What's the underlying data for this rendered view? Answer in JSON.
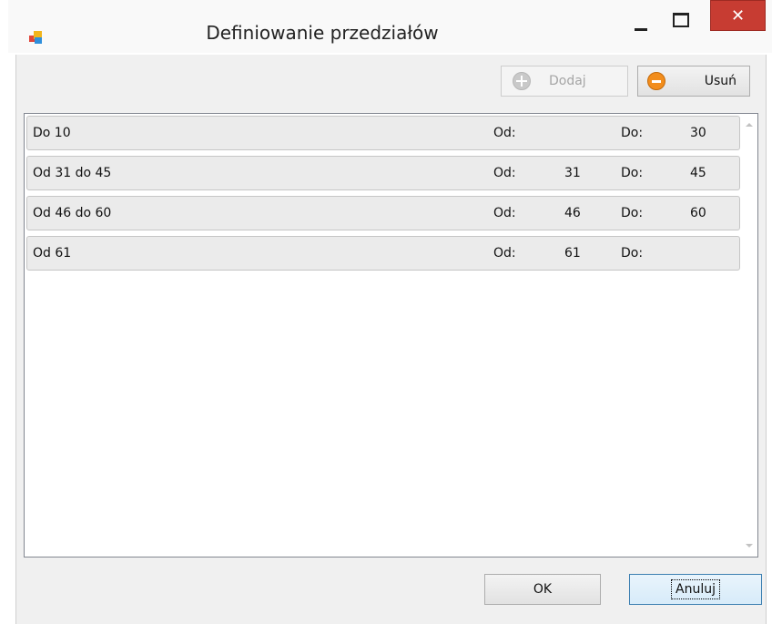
{
  "window": {
    "title": "Definiowanie przedziałów",
    "icons": {
      "app": "app-window-icon",
      "minimize": "minimize-icon",
      "maximize": "maximize-icon",
      "close": "close-icon"
    },
    "close_glyph": "✕"
  },
  "toolbar": {
    "add_label": "Dodaj",
    "add_enabled": false,
    "add_icon": "plus-circle-icon",
    "delete_label": "Usuń",
    "delete_icon": "minus-circle-icon"
  },
  "ranges": {
    "rows": [
      {
        "name": "Do 10",
        "od_label": "Od:",
        "od_value": "",
        "do_label": "Do:",
        "do_value": "30"
      },
      {
        "name": "Od 31 do 45",
        "od_label": "Od:",
        "od_value": "31",
        "do_label": "Do:",
        "do_value": "45"
      },
      {
        "name": "Od 46 do 60",
        "od_label": "Od:",
        "od_value": "46",
        "do_label": "Do:",
        "do_value": "60"
      },
      {
        "name": "Od 61",
        "od_label": "Od:",
        "od_value": "61",
        "do_label": "Do:",
        "do_value": ""
      }
    ]
  },
  "footer": {
    "ok_label": "OK",
    "cancel_label": "Anuluj"
  },
  "colors": {
    "close_button": "#c73c32",
    "delete_icon": "#f28d1c",
    "dialog_background": "#f0f0f0"
  }
}
